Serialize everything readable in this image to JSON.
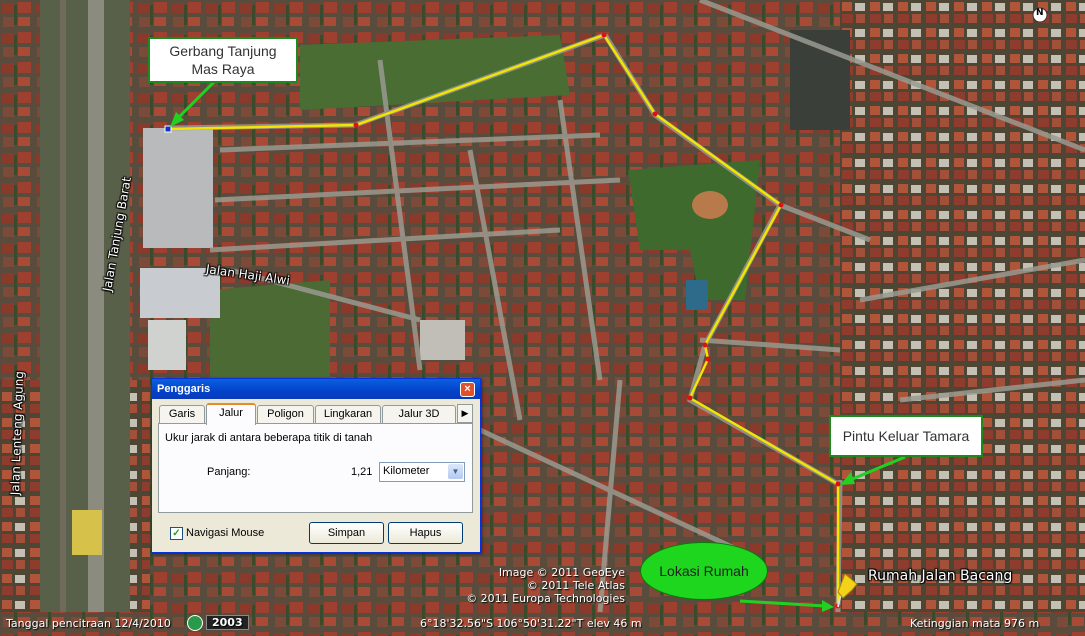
{
  "map": {
    "callouts": {
      "start_line1": "Gerbang Tanjung",
      "start_line2": "Mas Raya",
      "exit": "Pintu Keluar Tamara",
      "home": "Lokasi Rumah"
    },
    "streets": {
      "tanjung_barat": "Jalan Tanjung Barat",
      "haji_alwi": "Jalan Haji Alwi",
      "lenteng_agung": "Jalan Lenteng Agung"
    },
    "placemark_label": "Rumah Jalan Bacang",
    "compass": "N",
    "attribution": [
      "Image © 2011 GeoEye",
      "© 2011 Tele Atlas",
      "© 2011 Europa Technologies"
    ],
    "colors": {
      "path": "#f2e600",
      "vertex": "#e01010",
      "callout_border": "#1c8a1c",
      "oval_fill": "#1ed61e"
    }
  },
  "statusbar": {
    "imagery_date": "Tanggal pencitraan 12/4/2010",
    "year": "2003",
    "coords": "6°18'32.56\"S  106°50'31.22\"T  elev   46 m",
    "eye_alt": "Ketinggian mata    976 m"
  },
  "dialog": {
    "title": "Penggaris",
    "tabs": [
      "Garis",
      "Jalur",
      "Poligon",
      "Lingkaran",
      "Jalur 3D"
    ],
    "active_tab": "Jalur",
    "description": "Ukur jarak di antara beberapa titik di tanah",
    "length_label": "Panjang:",
    "length_value": "1,21",
    "unit": "Kilometer",
    "mouse_nav_label": "Navigasi Mouse",
    "mouse_nav_checked": true,
    "save_label": "Simpan",
    "clear_label": "Hapus"
  }
}
